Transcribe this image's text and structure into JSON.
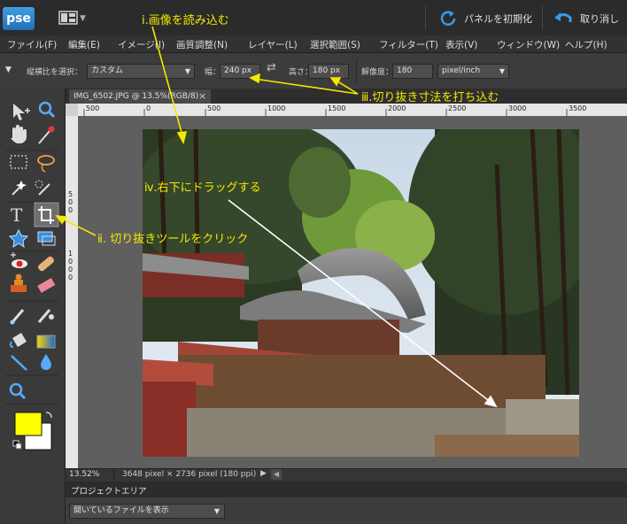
{
  "app": {
    "logo": "pse"
  },
  "toolbar": {
    "reset_panels_label": "パネルを初期化",
    "undo_label": "取り消し"
  },
  "menu": [
    "ファイル(F)",
    "編集(E)",
    "イメージ(I)",
    "画質調整(N)",
    "レイヤー(L)",
    "選択範囲(S)",
    "フィルター(T)",
    "表示(V)",
    "ウィンドウ(W)",
    "ヘルプ(H)"
  ],
  "options": {
    "aspect_label": "縦横比を選択：",
    "aspect_value": "カスタム",
    "width_label": "幅：",
    "width_value": "240 px",
    "height_label": "高さ：",
    "height_value": "180 px",
    "resolution_label": "解像度：",
    "resolution_value": "180",
    "resolution_unit": "pixel/inch"
  },
  "document": {
    "tab_title": "IMG_6502.JPG @ 13.5%(RGB/8)",
    "tab_close": "×",
    "zoom": "13.52%",
    "info": "3648 pixel × 2736 pixel (180 ppi)"
  },
  "ruler": {
    "h_ticks": [
      "500",
      "0",
      "500",
      "1000",
      "1500",
      "2000",
      "2500",
      "3000",
      "3500"
    ],
    "v_ticks": [
      "5",
      "0",
      "0",
      "1",
      "0",
      "0",
      "0"
    ]
  },
  "project": {
    "title": "プロジェクトエリア",
    "filter_value": "開いているファイルを表示"
  },
  "annotations": {
    "step1": "ⅰ.画像を読み込む",
    "step2": "ⅱ. 切り抜きツールをクリック",
    "step3": "ⅲ.切り抜き寸法を打ち込む",
    "step4": "ⅳ.右下にドラッグする"
  },
  "colors": {
    "accent_yellow": "#f5e800",
    "foreground": "#ffff00",
    "background": "#ffffff"
  }
}
